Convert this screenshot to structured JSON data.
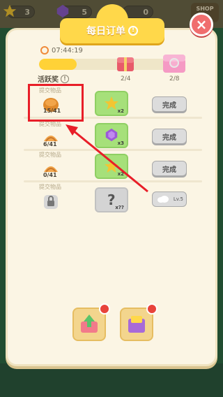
{
  "top_bar": {
    "resources": [
      {
        "icon": "star-icon",
        "value": "3"
      },
      {
        "icon": "purple-gem-icon",
        "value": "5"
      },
      {
        "icon": "unknown-resource-icon",
        "value": "0"
      }
    ],
    "shop_label": "SHOP"
  },
  "dialog": {
    "title": "每日订单",
    "info_glyph": "!",
    "close_glyph": "×",
    "timer": "07:44:19",
    "active_label": "活跃奖",
    "progress": 0.26,
    "milestones": [
      {
        "label": "2/4",
        "icon": "red-chest-icon"
      },
      {
        "label": "2/8",
        "icon": "pink-chest-icon"
      }
    ]
  },
  "orders": [
    {
      "label": "提交物品",
      "item_icon": "bread-bun-icon",
      "count": "15/41",
      "reward_icon": "star-icon",
      "reward_qty": "x2",
      "button": "完成"
    },
    {
      "label": "提交物品",
      "item_icon": "croissant-icon",
      "count": "6/41",
      "reward_icon": "purple-gem-icon",
      "reward_qty": "x3",
      "button": "完成"
    },
    {
      "label": "提交物品",
      "item_icon": "croissant-icon",
      "count": "0/41",
      "reward_icon": "star-icon",
      "reward_qty": "x2",
      "button": "完成"
    },
    {
      "label": "提交物品",
      "item_icon": "lock-icon",
      "count": "",
      "reward_icon": "question-icon",
      "reward_qty": "x??",
      "lock_tag": "Lv.5"
    }
  ],
  "bottom_boxes": [
    {
      "icon": "green-arrow-gift-icon"
    },
    {
      "icon": "purple-gift-box-icon"
    }
  ],
  "colors": {
    "highlight": "#e81e28",
    "accent_yellow": "#ffd84a",
    "reward_green": "#a6e07a"
  }
}
